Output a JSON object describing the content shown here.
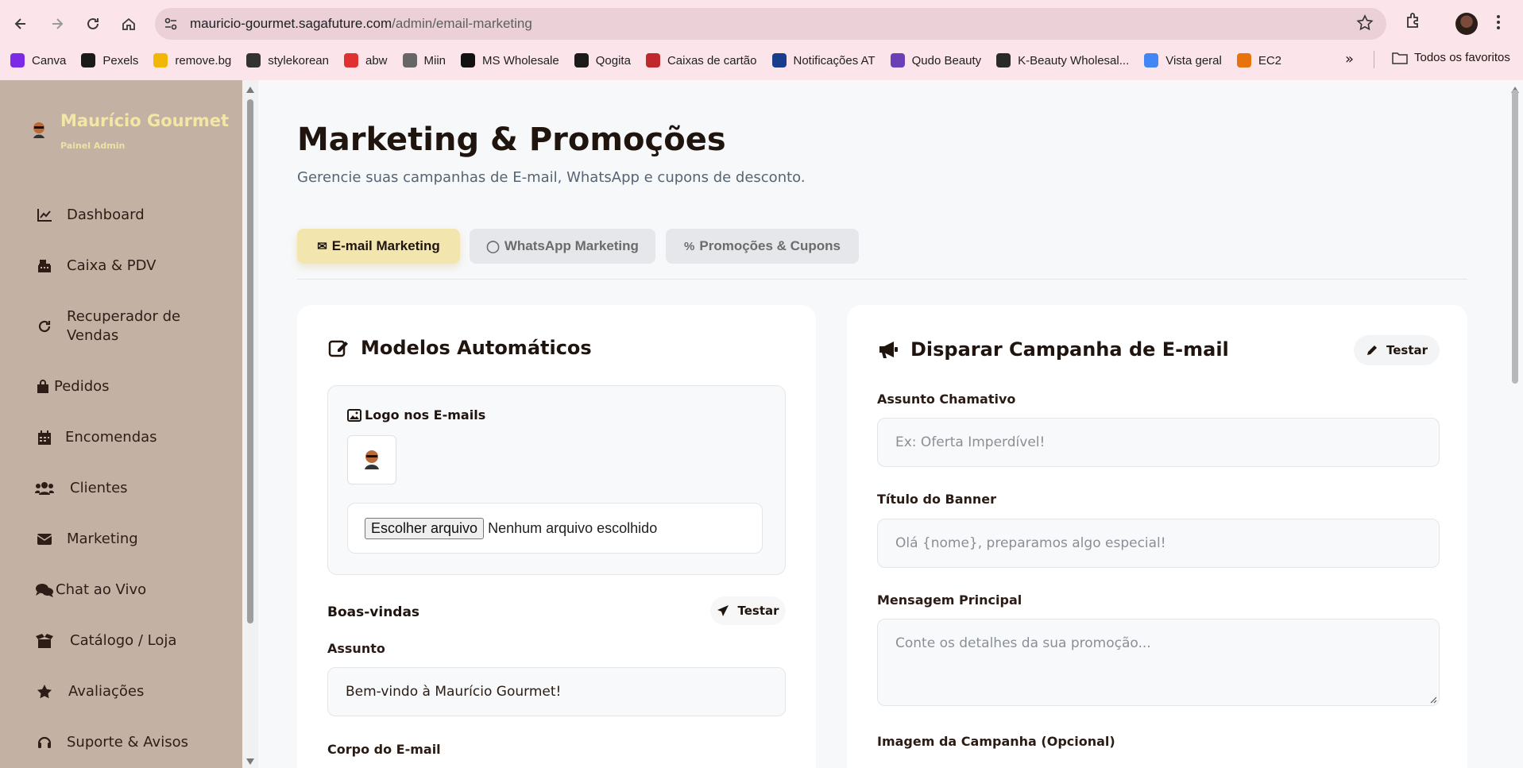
{
  "browser": {
    "url_host": "mauricio-gourmet.sagafuture.com",
    "url_path": "/admin/email-marketing",
    "bookmarks": [
      {
        "label": "Canva",
        "color": "#7d2ae8"
      },
      {
        "label": "Pexels",
        "color": "#1a1a1a"
      },
      {
        "label": "remove.bg",
        "color": "#f2b705"
      },
      {
        "label": "stylekorean",
        "color": "#333333"
      },
      {
        "label": "abw",
        "color": "#e03030"
      },
      {
        "label": "Miin",
        "color": "#666666"
      },
      {
        "label": "MS Wholesale",
        "color": "#111111"
      },
      {
        "label": "Qogita",
        "color": "#1b1b1b"
      },
      {
        "label": "Caixas de cartão",
        "color": "#c0282d"
      },
      {
        "label": "Notificações AT",
        "color": "#1a3c8c"
      },
      {
        "label": "Qudo Beauty",
        "color": "#6b3fb5"
      },
      {
        "label": "K-Beauty Wholesal...",
        "color": "#2a2a2a"
      },
      {
        "label": "Vista geral",
        "color": "#4285f4"
      },
      {
        "label": "EC2",
        "color": "#e8730c"
      }
    ],
    "bookmarks_more": "»",
    "all_bookmarks": "Todos os favoritos"
  },
  "sidebar": {
    "brand_name": "Maurício Gourmet",
    "brand_sub": "Painel Admin",
    "items": [
      {
        "label": "Dashboard",
        "icon": "chart-line-icon"
      },
      {
        "label": "Caixa & PDV",
        "icon": "cash-register-icon"
      },
      {
        "label": "Recuperador de Vendas",
        "icon": "refresh-icon"
      },
      {
        "label": "Pedidos",
        "icon": "shopping-bag-icon"
      },
      {
        "label": "Encomendas",
        "icon": "calendar-icon"
      },
      {
        "label": "Clientes",
        "icon": "users-icon"
      },
      {
        "label": "Marketing",
        "icon": "envelope-icon"
      },
      {
        "label": "Chat ao Vivo",
        "icon": "chat-icon"
      },
      {
        "label": "Catálogo / Loja",
        "icon": "box-open-icon"
      },
      {
        "label": "Avaliações",
        "icon": "star-icon"
      },
      {
        "label": "Suporte & Avisos",
        "icon": "headset-icon"
      }
    ]
  },
  "page": {
    "title": "Marketing & Promoções",
    "subtitle": "Gerencie suas campanhas de E-mail, WhatsApp e cupons de desconto."
  },
  "tabs": [
    {
      "label": "E-mail Marketing",
      "icon": "✉",
      "active": true
    },
    {
      "label": "WhatsApp Marketing",
      "icon": "◯",
      "active": false
    },
    {
      "label": "Promoções & Cupons",
      "icon": "%",
      "active": false
    }
  ],
  "templates_card": {
    "title": "Modelos Automáticos",
    "logo_label": "Logo nos E-mails",
    "file_button": "Escolher arquivo",
    "file_status": "Nenhum arquivo escolhido",
    "welcome_title": "Boas-vindas",
    "test_label": "Testar",
    "subject_label": "Assunto",
    "subject_value": "Bem-vindo à Maurício Gourmet!",
    "body_label": "Corpo do E-mail"
  },
  "campaign_card": {
    "title": "Disparar Campanha de E-mail",
    "test_label": "Testar",
    "subject_label": "Assunto Chamativo",
    "subject_placeholder": "Ex: Oferta Imperdível!",
    "banner_label": "Título do Banner",
    "banner_placeholder": "Olá {nome}, preparamos algo especial!",
    "message_label": "Mensagem Principal",
    "message_placeholder": "Conte os detalhes da sua promoção...",
    "image_label": "Imagem da Campanha (Opcional)"
  },
  "colors": {
    "sidebar_bg": "#c3b2a4",
    "brand_text": "#f4e7a6",
    "active_tab_bg": "#f2e5ae",
    "chrome_bg": "#fbe4ea"
  }
}
